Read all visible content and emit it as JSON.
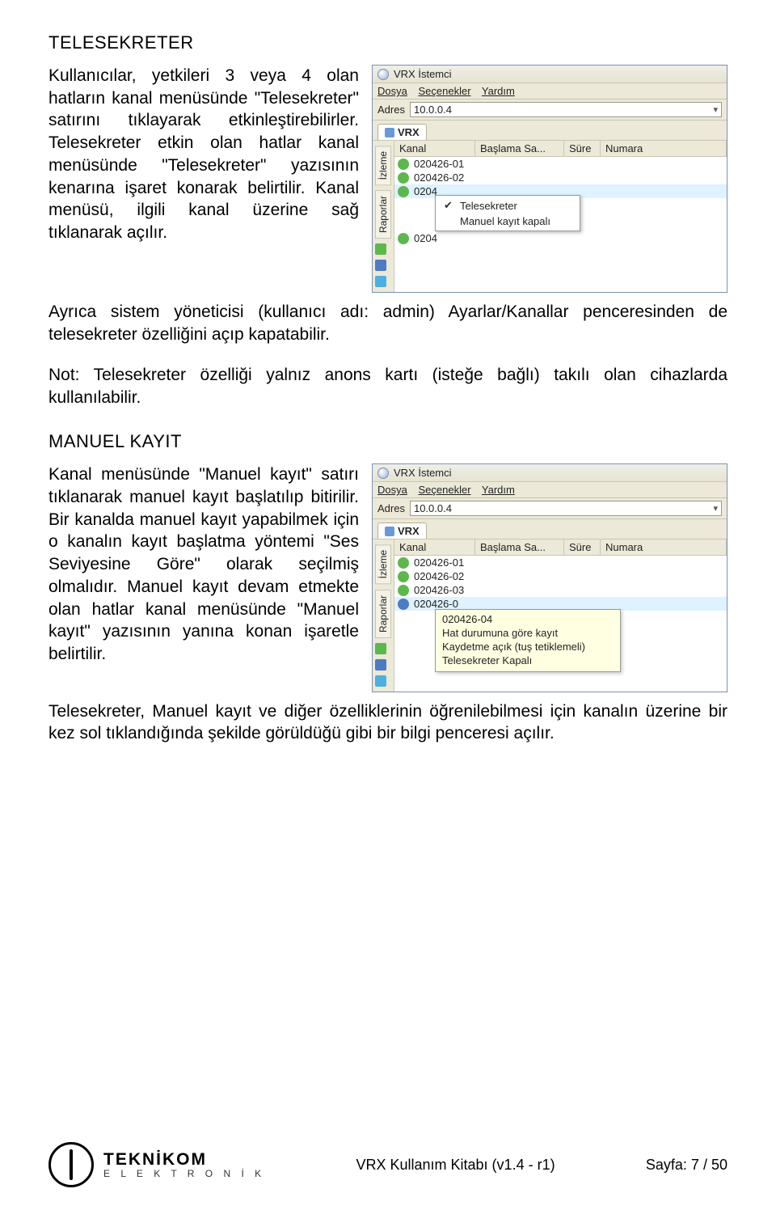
{
  "sec1": {
    "title": "TELESEKRETER",
    "p1": "Kullanıcılar, yetkileri 3 veya 4 olan hatların kanal menüsünde \"Telesekreter\" satırını tıklayarak etkinleştirebilirler. Telesekreter etkin olan hatlar kanal menüsünde \"Telesekreter\" yazısının kenarına işaret konarak belirtilir. Kanal menüsü, ilgili kanal üzerine sağ tıklanarak açılır.",
    "p2": "Ayrıca sistem yöneticisi (kullanıcı adı: admin) Ayarlar/Kanallar penceresinden de telesekreter özelliğini açıp kapatabilir.",
    "p3": "Not: Telesekreter özelliği yalnız anons kartı (isteğe bağlı) takılı olan cihazlarda kullanılabilir."
  },
  "sec2": {
    "title": "MANUEL KAYIT",
    "p1": "Kanal menüsünde \"Manuel kayıt\" satırı tıklanarak manuel kayıt başlatılıp bitirilir. Bir kanalda manuel kayıt yapabilmek için o kanalın kayıt başlatma yöntemi \"Ses Seviyesine Göre\" olarak seçilmiş olmalıdır. Manuel kayıt devam etmekte olan hatlar kanal menüsünde \"Manuel kayıt\" yazısının yanına konan işaretle belirtilir.",
    "p2": "Telesekreter, Manuel kayıt ve diğer özelliklerinin öğrenilebilmesi için kanalın üzerine bir kez sol tıklandığında şekilde görüldüğü gibi bir bilgi penceresi açılır."
  },
  "win": {
    "title": "VRX İstemci",
    "menu": {
      "m1": "Dosya",
      "m2": "Seçenekler",
      "m3": "Yardım"
    },
    "addr_label": "Adres",
    "addr_value": "10.0.0.4",
    "tab": "VRX",
    "side": {
      "izleme": "İzleme",
      "raporlar": "Raporlar"
    },
    "cols": {
      "kanal": "Kanal",
      "baslama": "Başlama Sa...",
      "sure": "Süre",
      "numara": "Numara"
    }
  },
  "fig1": {
    "rows": [
      "020426-01",
      "020426-02",
      "0204",
      "0204"
    ],
    "ctx": {
      "item1": "Telesekreter",
      "item2": "Manuel kayıt kapalı"
    }
  },
  "fig2": {
    "rows": [
      "020426-01",
      "020426-02",
      "020426-03",
      "020426-0"
    ],
    "tip": {
      "l1": "020426-04",
      "l2": "Hat durumuna göre kayıt",
      "l3": "Kaydetme açık (tuş tetiklemeli)",
      "l4": "Telesekreter Kapalı"
    }
  },
  "footer": {
    "brand1": "TEKNİKOM",
    "brand2": "E L E K T R O N İ K",
    "center": "VRX Kullanım Kitabı (v1.4 - r1)",
    "right": "Sayfa: 7 / 50"
  }
}
